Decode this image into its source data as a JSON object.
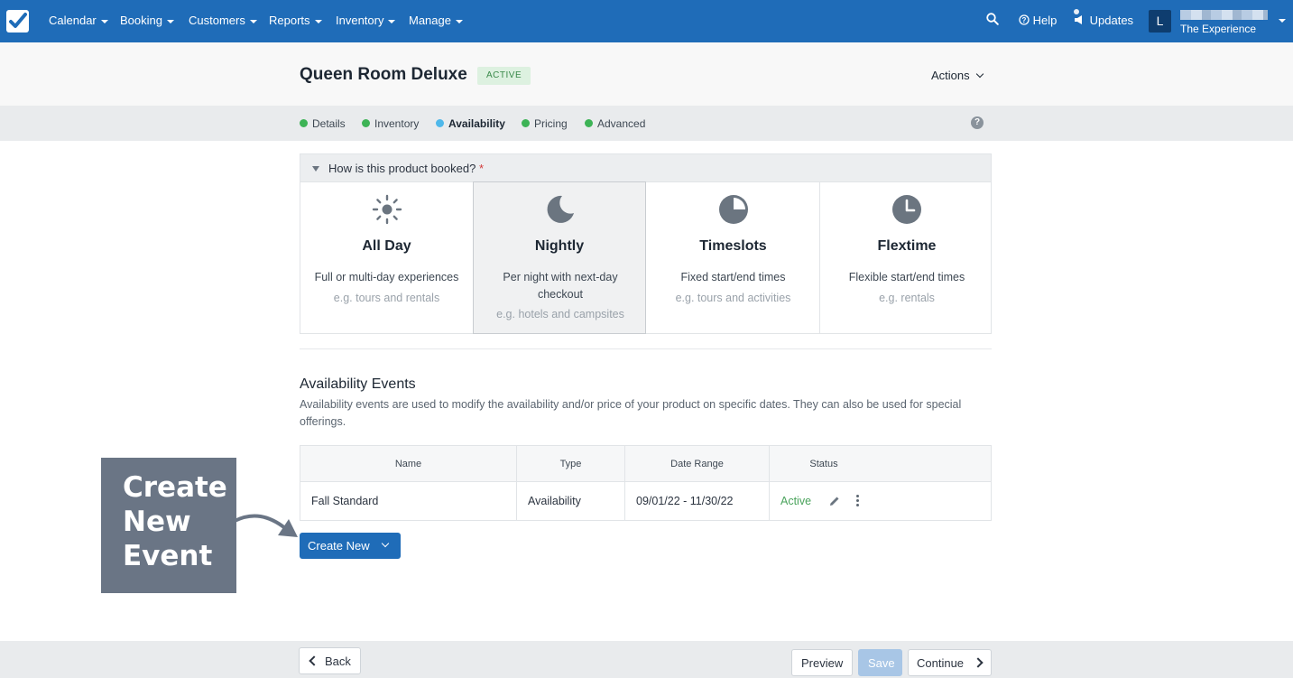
{
  "nav": {
    "items": [
      {
        "label": "Calendar"
      },
      {
        "label": "Booking"
      },
      {
        "label": "Customers"
      },
      {
        "label": "Reports"
      },
      {
        "label": "Inventory"
      },
      {
        "label": "Manage"
      }
    ],
    "help_label": "Help",
    "updates_label": "Updates",
    "avatar_initial": "L",
    "account_name": "The Experience"
  },
  "product": {
    "title": "Queen Room Deluxe",
    "status": "ACTIVE",
    "actions_label": "Actions"
  },
  "steps": [
    {
      "label": "Details",
      "color": "#3db356"
    },
    {
      "label": "Inventory",
      "color": "#3db356"
    },
    {
      "label": "Availability",
      "color": "#4fb8ea"
    },
    {
      "label": "Pricing",
      "color": "#3db356"
    },
    {
      "label": "Advanced",
      "color": "#3db356"
    }
  ],
  "help_icon": "?",
  "booking_section": {
    "question": "How is this product booked?",
    "required_mark": "*",
    "options": [
      {
        "icon": "sun-icon",
        "title": "All Day",
        "desc": "Full or multi-day experiences",
        "example": "e.g. tours and rentals",
        "selected": false
      },
      {
        "icon": "moon-icon",
        "title": "Nightly",
        "desc": "Per night with next-day checkout",
        "example": "e.g. hotels and campsites",
        "selected": true
      },
      {
        "icon": "pie-clock-icon",
        "title": "Timeslots",
        "desc": "Fixed start/end times",
        "example": "e.g. tours and activities",
        "selected": false
      },
      {
        "icon": "clock-icon",
        "title": "Flextime",
        "desc": "Flexible start/end times",
        "example": "e.g. rentals",
        "selected": false
      }
    ]
  },
  "events": {
    "title": "Availability Events",
    "description": "Availability events are used to modify the availability and/or price of your product on specific dates. They can also be used for special offerings.",
    "columns": [
      "Name",
      "Type",
      "Date Range",
      "Status"
    ],
    "rows": [
      {
        "name": "Fall Standard",
        "type": "Availability",
        "date_range": "09/01/22 - 11/30/22",
        "status": "Active"
      }
    ],
    "create_label": "Create New"
  },
  "callout": {
    "text_line1": "Create",
    "text_line2": "New",
    "text_line3": "Event",
    "color": "#6a7585"
  },
  "footer": {
    "back_label": "Back",
    "preview_label": "Preview",
    "save_label": "Save",
    "continue_label": "Continue"
  },
  "colors": {
    "brand": "#1f6cb8",
    "active_green": "#4aa35c"
  }
}
